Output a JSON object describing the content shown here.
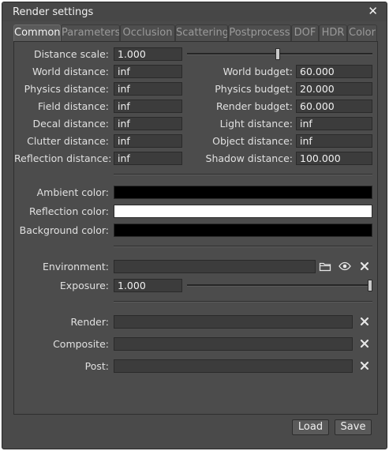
{
  "window": {
    "title": "Render settings",
    "close_glyph": "✕"
  },
  "tabs": [
    {
      "label": "Common",
      "active": true
    },
    {
      "label": "Parameters"
    },
    {
      "label": "Occlusion"
    },
    {
      "label": "Scattering"
    },
    {
      "label": "Postprocess"
    },
    {
      "label": "DOF"
    },
    {
      "label": "HDR"
    },
    {
      "label": "Color"
    }
  ],
  "common": {
    "distance_scale": {
      "label": "Distance scale:",
      "value": "1.000",
      "slider_fraction": 0.49
    },
    "left_fields": [
      {
        "label": "World distance:",
        "value": "inf"
      },
      {
        "label": "Physics distance:",
        "value": "inf"
      },
      {
        "label": "Field distance:",
        "value": "inf"
      },
      {
        "label": "Decal distance:",
        "value": "inf"
      },
      {
        "label": "Clutter distance:",
        "value": "inf"
      },
      {
        "label": "Reflection distance:",
        "value": "inf"
      }
    ],
    "right_fields": [
      {
        "label": "World budget:",
        "value": "60.000"
      },
      {
        "label": "Physics budget:",
        "value": "20.000"
      },
      {
        "label": "Render budget:",
        "value": "60.000"
      },
      {
        "label": "Light distance:",
        "value": "inf"
      },
      {
        "label": "Object distance:",
        "value": "inf"
      },
      {
        "label": "Shadow distance:",
        "value": "100.000"
      }
    ],
    "colors": [
      {
        "label": "Ambient color:",
        "color": "#000000"
      },
      {
        "label": "Reflection color:",
        "color": "#ffffff"
      },
      {
        "label": "Background color:",
        "color": "#000000"
      }
    ],
    "environment": {
      "label": "Environment:",
      "value": "",
      "icons": [
        "folder-icon",
        "eye-icon",
        "clear-icon"
      ]
    },
    "exposure": {
      "label": "Exposure:",
      "value": "1.000",
      "slider_fraction": 1.0
    },
    "materials": [
      {
        "label": "Render:",
        "value": ""
      },
      {
        "label": "Composite:",
        "value": ""
      },
      {
        "label": "Post:",
        "value": ""
      }
    ]
  },
  "footer": {
    "load_label": "Load",
    "save_label": "Save"
  }
}
